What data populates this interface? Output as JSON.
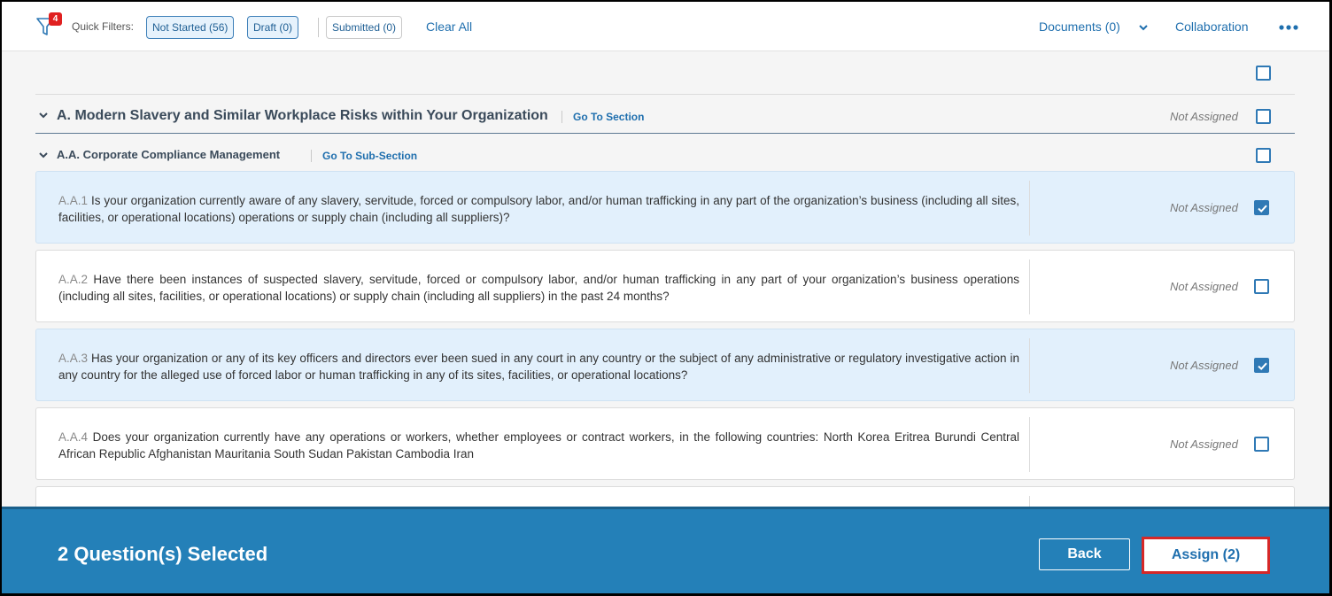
{
  "topbar": {
    "filter_badge": "4",
    "quick_filters_label": "Quick Filters:",
    "chips": [
      "Not Started (56)",
      "Draft (0)",
      "Submitted (0)"
    ],
    "clear_all": "Clear All",
    "documents": "Documents (0)",
    "collaboration": "Collaboration",
    "more_icon": "more-horizontal-icon"
  },
  "section": {
    "title": "A. Modern Slavery and Similar Workplace Risks within Your Organization",
    "goto": "Go To Section",
    "status": "Not Assigned"
  },
  "subsection": {
    "title": "A.A. Corporate Compliance Management",
    "goto": "Go To Sub-Section"
  },
  "questions": [
    {
      "number": "A.A.1",
      "text": "Is your organization currently aware of any slavery, servitude, forced or compulsory labor, and/or human trafficking in any part of the organization’s business (including all sites, facilities, or operational locations) operations or supply chain (including all suppliers)?",
      "status": "Not Assigned",
      "selected": true
    },
    {
      "number": "A.A.2",
      "text": "Have there been instances of suspected slavery, servitude, forced or compulsory labor, and/or human trafficking in any part of your organization’s business operations (including all sites, facilities, or operational locations) or supply chain (including all suppliers) in the past 24 months?",
      "status": "Not Assigned",
      "selected": false
    },
    {
      "number": "A.A.3",
      "text": "Has your organization or any of its key officers and directors ever been sued in any court in any country or the subject of any administrative or regulatory investigative action in any country for the alleged use of forced labor or human trafficking in any of its sites, facilities, or operational locations?",
      "status": "Not Assigned",
      "selected": true
    },
    {
      "number": "A.A.4",
      "text": "Does your organization currently have any operations or workers, whether employees or contract workers, in the following countries: North Korea Eritrea Burundi Central African Republic Afghanistan Mauritania South Sudan Pakistan Cambodia Iran",
      "status": "Not Assigned",
      "selected": false
    }
  ],
  "footer": {
    "selected_text": "2 Question(s) Selected",
    "back": "Back",
    "assign": "Assign (2)"
  },
  "colors": {
    "accent": "#2f79b5",
    "footer_bg": "#2480b8",
    "selected_row": "#e2f0fc",
    "highlight": "#d62828"
  }
}
